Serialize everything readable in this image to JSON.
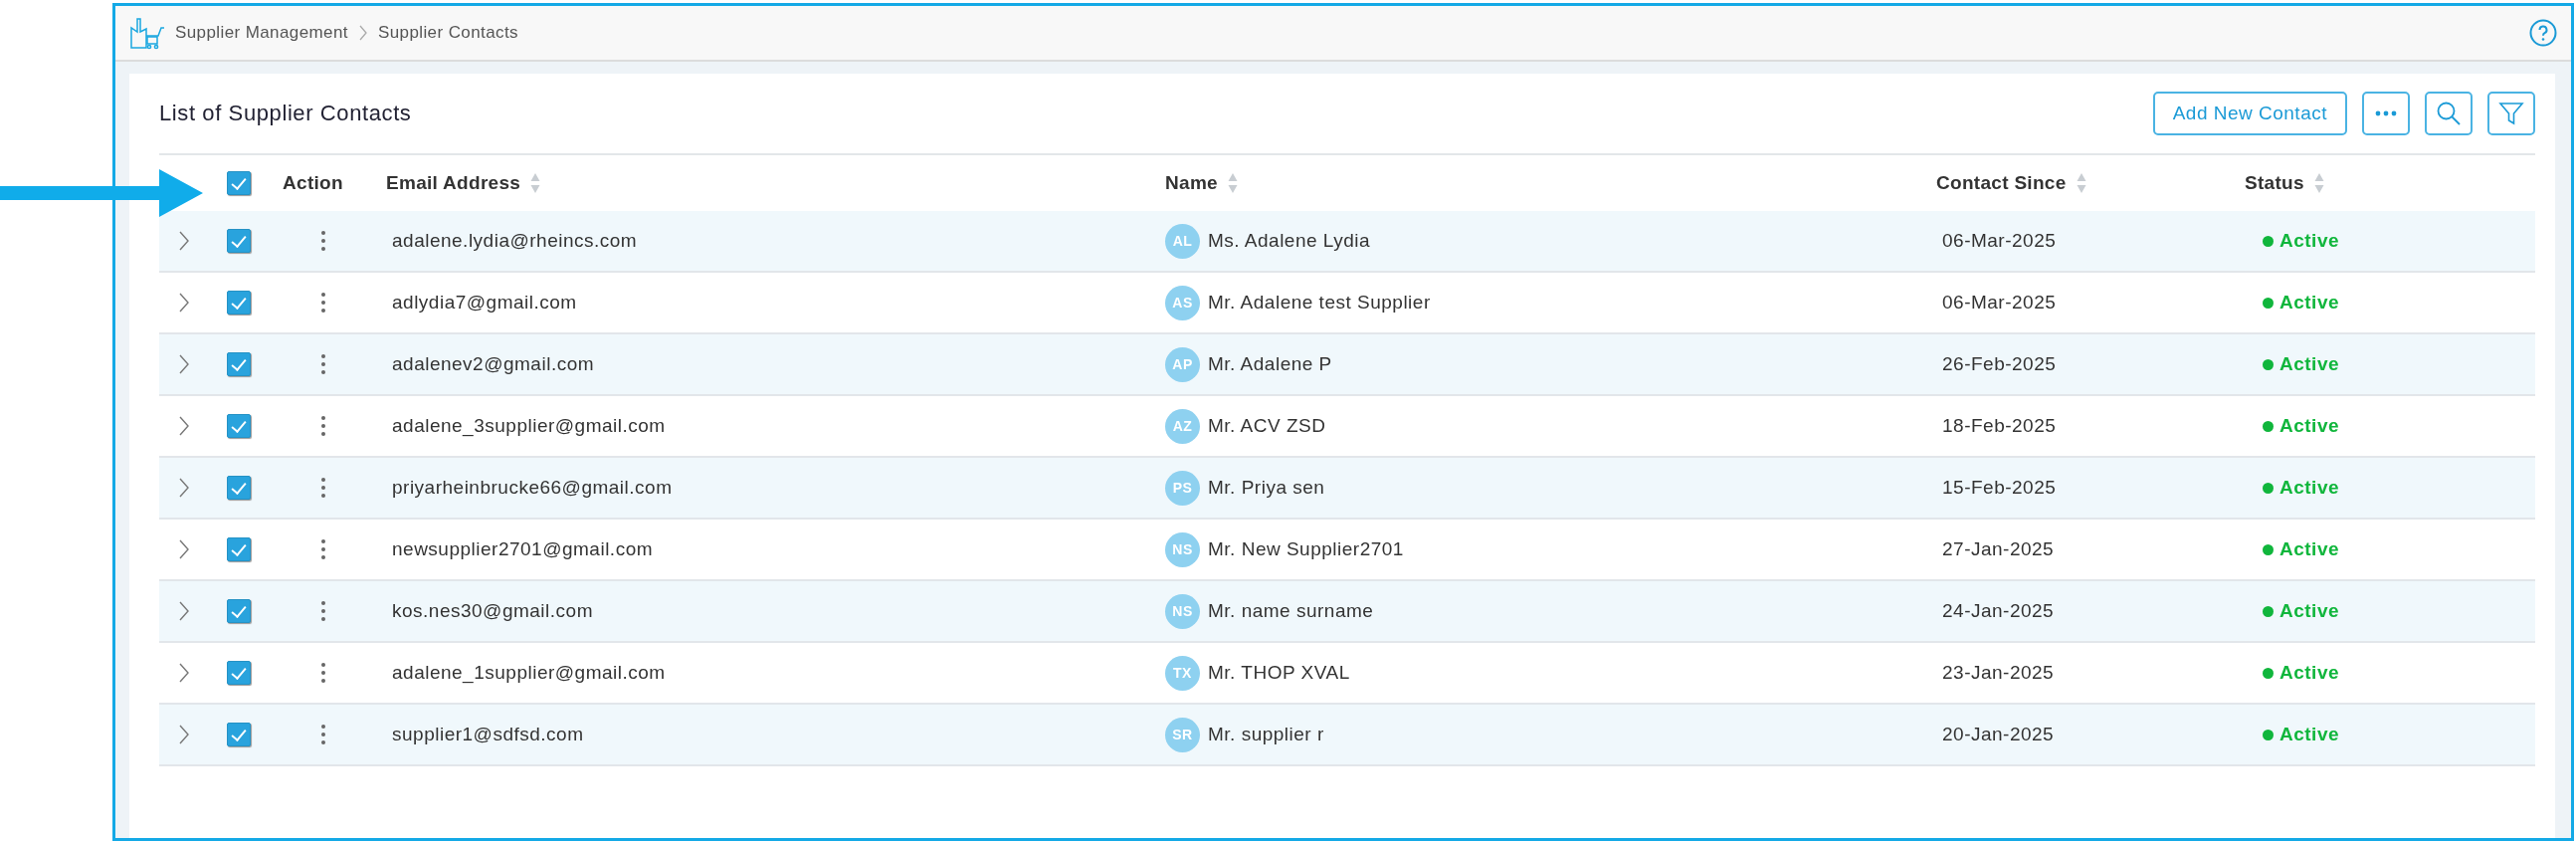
{
  "breadcrumb": {
    "items": [
      "Supplier Management",
      "Supplier Contacts"
    ]
  },
  "title": "List of Supplier Contacts",
  "toolbar": {
    "add_button": "Add New Contact"
  },
  "table": {
    "select_all": {
      "checked": true
    },
    "columns": [
      {
        "label": "Action",
        "sortable": false
      },
      {
        "label": "Email Address",
        "sortable": true
      },
      {
        "label": "Name",
        "sortable": true
      },
      {
        "label": "Contact Since",
        "sortable": true
      },
      {
        "label": "Status",
        "sortable": true
      }
    ],
    "rows": [
      {
        "expanded": false,
        "checked": true,
        "email": "adalene.lydia@rheincs.com",
        "initials": "AL",
        "name": "Ms. Adalene Lydia",
        "contact_since": "06-Mar-2025",
        "status": "Active",
        "kind": "active"
      },
      {
        "expanded": false,
        "checked": true,
        "email": "adlydia7@gmail.com",
        "initials": "AS",
        "name": "Mr. Adalene test Supplier",
        "contact_since": "06-Mar-2025",
        "status": "Active",
        "kind": "active"
      },
      {
        "expanded": false,
        "checked": true,
        "email": "adalenev2@gmail.com",
        "initials": "AP",
        "name": "Mr. Adalene P",
        "contact_since": "26-Feb-2025",
        "status": "Active",
        "kind": "active"
      },
      {
        "expanded": false,
        "checked": true,
        "email": "adalene_3supplier@gmail.com",
        "initials": "AZ",
        "name": "Mr. ACV ZSD",
        "contact_since": "18-Feb-2025",
        "status": "Active",
        "kind": "active"
      },
      {
        "expanded": false,
        "checked": true,
        "email": "priyarheinbrucke66@gmail.com",
        "initials": "PS",
        "name": "Mr. Priya sen",
        "contact_since": "15-Feb-2025",
        "status": "Active",
        "kind": "active"
      },
      {
        "expanded": false,
        "checked": true,
        "email": "newsupplier2701@gmail.com",
        "initials": "NS",
        "name": "Mr. New Supplier2701",
        "contact_since": "27-Jan-2025",
        "status": "Active",
        "kind": "active"
      },
      {
        "expanded": false,
        "checked": true,
        "email": "kos.nes30@gmail.com",
        "initials": "NS",
        "name": "Mr. name surname",
        "contact_since": "24-Jan-2025",
        "status": "Active",
        "kind": "active"
      },
      {
        "expanded": false,
        "checked": true,
        "email": "adalene_1supplier@gmail.com",
        "initials": "TX",
        "name": "Mr. THOP XVAL",
        "contact_since": "23-Jan-2025",
        "status": "Active",
        "kind": "active"
      },
      {
        "expanded": false,
        "checked": true,
        "email": "supplier1@sdfsd.com",
        "initials": "SR",
        "name": "Mr. supplier r",
        "contact_since": "20-Jan-2025",
        "status": "Active",
        "kind": "active"
      }
    ]
  }
}
